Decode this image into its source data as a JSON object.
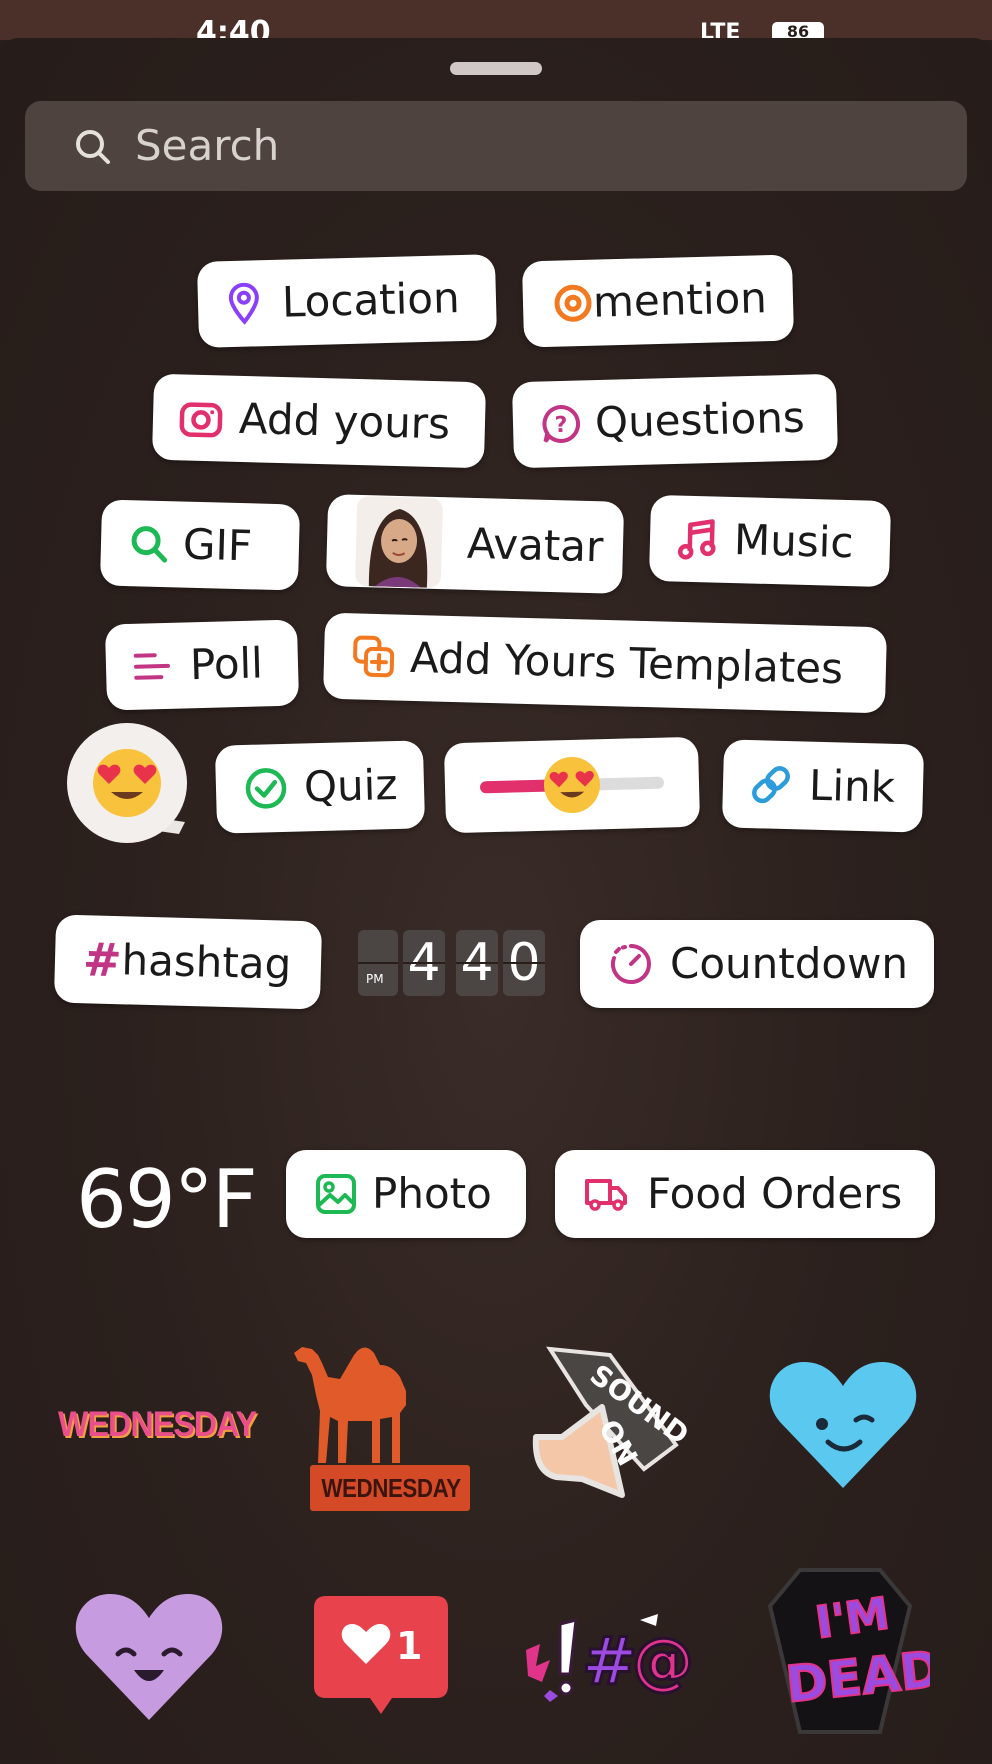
{
  "status": {
    "time": "4:40",
    "network": "LTE",
    "battery": "86"
  },
  "search": {
    "placeholder": "Search",
    "icon": "search-icon"
  },
  "stickers": {
    "location": "Location",
    "mention": "mention",
    "add_yours": "Add yours",
    "questions": "Questions",
    "gif": "GIF",
    "avatar": "Avatar",
    "music": "Music",
    "poll": "Poll",
    "add_yours_templates": "Add Yours Templates",
    "quiz": "Quiz",
    "link": "Link",
    "hashtag": "hashtag",
    "hashtag_symbol": "#",
    "clock": {
      "ampm": "PM",
      "hour": "4",
      "min1": "4",
      "min2": "0"
    },
    "countdown": "Countdown",
    "temperature": "69°F",
    "photo": "Photo",
    "food_orders": "Food Orders",
    "day_text": "WEDNESDAY",
    "camel_day": "WEDNESDAY",
    "sound_on": "SOUND ON",
    "like_count": "1",
    "im_dead": "I'M DEAD"
  },
  "colors": {
    "background": "#2a1e1a",
    "location_icon": "#8a3ffc",
    "mention_icon": "#f37920",
    "add_yours_icon": "#e1306c",
    "questions_icon": "#c13584",
    "gif_icon": "#1db954",
    "music_icon": "#e1306c",
    "poll_icon": "#c13584",
    "templates_icon": "#f37920",
    "quiz_icon": "#1db954",
    "link_icon": "#2d9cdb",
    "hashtag": "#c13584",
    "countdown_icon": "#c13584",
    "photo_icon": "#1db954",
    "food_icon": "#e1306c",
    "slider_fill": "#e1306c"
  },
  "emoji_slider": {
    "level": 0.5
  }
}
